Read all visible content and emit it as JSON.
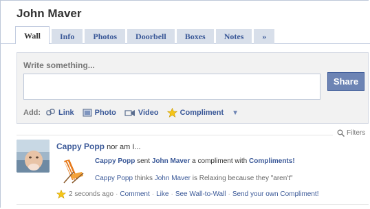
{
  "profile": {
    "name": "John Maver"
  },
  "tabs": [
    {
      "label": "Wall",
      "active": true
    },
    {
      "label": "Info"
    },
    {
      "label": "Photos"
    },
    {
      "label": "Doorbell"
    },
    {
      "label": "Boxes"
    },
    {
      "label": "Notes"
    },
    {
      "label": "»"
    }
  ],
  "composer": {
    "label": "Write something...",
    "value": "",
    "share_label": "Share",
    "add_label": "Add:",
    "attachments": [
      {
        "label": "Link",
        "icon": "link-icon"
      },
      {
        "label": "Photo",
        "icon": "photo-icon"
      },
      {
        "label": "Video",
        "icon": "video-icon"
      },
      {
        "label": "Compliment",
        "icon": "star-icon"
      }
    ]
  },
  "filters": {
    "label": "Filters",
    "icon": "magnifier-icon"
  },
  "story": {
    "actor": "Cappy Popp",
    "status": "nor am I...",
    "line1": {
      "actor": "Cappy Popp",
      "verb": "sent",
      "target": "John Maver",
      "middle": "a compliment with",
      "app": "Compliments!"
    },
    "line2": {
      "actor": "Cappy Popp",
      "verb": "thinks",
      "target": "John Maver",
      "rest": "is Relaxing because they \"aren't\""
    },
    "footer": {
      "time": "2 seconds ago",
      "actions": [
        "Comment",
        "Like",
        "See Wall-to-Wall",
        "Send your own Compliment!"
      ]
    }
  },
  "colors": {
    "link": "#3b5998",
    "tab_bg": "#d8dfea",
    "share_bg": "#6d84b4",
    "star": "#f5c518"
  }
}
